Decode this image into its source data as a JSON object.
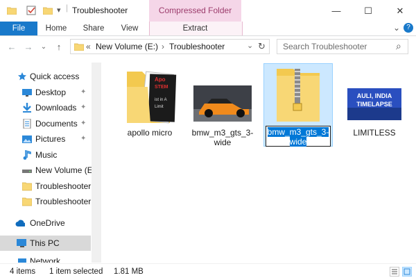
{
  "window": {
    "title": "Troubleshooter",
    "context_tab": "Compressed Folder Tools",
    "minimize_glyph": "—",
    "maximize_glyph": "☐",
    "close_glyph": "✕"
  },
  "ribbon": {
    "tabs": [
      "File",
      "Home",
      "Share",
      "View",
      "Extract"
    ],
    "collapse_glyph": "⌄",
    "help_glyph": "?"
  },
  "nav": {
    "back_glyph": "←",
    "forward_glyph": "→",
    "recent_glyph": "⌄",
    "up_glyph": "↑",
    "breadcrumb": [
      "«",
      "New Volume (E:)",
      "›",
      "Troubleshooter"
    ],
    "dropdown_glyph": "⌄",
    "refresh_glyph": "↻",
    "search_placeholder": "Search Troubleshooter",
    "search_glyph": "⌕"
  },
  "sidebar": {
    "items": [
      {
        "label": "Quick access",
        "icon": "star-icon",
        "pinned": false
      },
      {
        "label": "Desktop",
        "icon": "desktop-icon",
        "pinned": true
      },
      {
        "label": "Downloads",
        "icon": "download-icon",
        "pinned": true
      },
      {
        "label": "Documents",
        "icon": "documents-icon",
        "pinned": true
      },
      {
        "label": "Pictures",
        "icon": "pictures-icon",
        "pinned": true
      },
      {
        "label": "Music",
        "icon": "music-icon",
        "pinned": false
      },
      {
        "label": "New Volume (E:)",
        "icon": "drive-icon",
        "pinned": false
      },
      {
        "label": "Troubleshooter",
        "icon": "folder-icon",
        "pinned": false
      },
      {
        "label": "Troubleshooter W",
        "icon": "folder-icon",
        "pinned": false
      },
      {
        "label": "OneDrive",
        "icon": "cloud-icon",
        "pinned": false
      },
      {
        "label": "This PC",
        "icon": "computer-icon",
        "pinned": false
      },
      {
        "label": "Network",
        "icon": "network-icon",
        "pinned": false
      }
    ],
    "pin_glyph": "📌"
  },
  "files": [
    {
      "name": "apollo micro",
      "type": "folder"
    },
    {
      "name": "bmw_m3_gts_3-wide",
      "type": "image"
    },
    {
      "name": "bmw_m3_gts_3-wide",
      "type": "zip",
      "selected": true,
      "renaming": true
    },
    {
      "name": "LIMITLESS",
      "type": "image"
    }
  ],
  "thumb_text": {
    "limitless": "AULI, INDIA TIMELAPSE",
    "apollo_lines": [
      "Apo",
      "STEM",
      "ist in A",
      "Limit"
    ]
  },
  "status": {
    "count": "4 items",
    "selection": "1 item selected",
    "size": "1.81 MB"
  },
  "colors": {
    "accent": "#1979ca",
    "selection": "#cce8ff",
    "context_tab": "#f5d6e8",
    "folder": "#f8d775"
  }
}
